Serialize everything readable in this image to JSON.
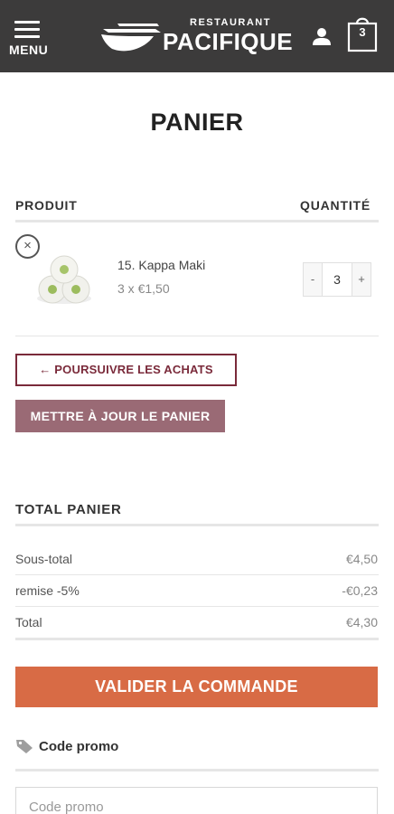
{
  "header": {
    "menu_label": "MENU",
    "logo_small": "RESTAURANT",
    "logo_big": "PACIFIQUE",
    "cart_count": "3",
    "background": "#3c3b3b"
  },
  "page": {
    "title": "PANIER"
  },
  "table": {
    "col_product": "PRODUIT",
    "col_quantity": "QUANTITÉ"
  },
  "item": {
    "remove_glyph": "×",
    "name": "15. Kappa Maki",
    "price": "3 x €1,50",
    "qty_minus": "-",
    "qty_value": "3",
    "qty_plus": "+"
  },
  "actions": {
    "continue_label": "← POURSUIVRE LES ACHATS",
    "update_label": "METTRE À JOUR LE PANIER"
  },
  "totals": {
    "title": "TOTAL PANIER",
    "rows": [
      {
        "label": "Sous-total",
        "value": "€4,50"
      },
      {
        "label": "remise -5%",
        "value": "-€0,23"
      },
      {
        "label": "Total",
        "value": "€4,30"
      }
    ]
  },
  "checkout": {
    "label": "VALIDER LA COMMANDE",
    "color": "#d86b45"
  },
  "promo": {
    "heading": "Code promo",
    "placeholder": "Code promo"
  },
  "icons": {
    "menu": "hamburger-icon",
    "user": "user-icon",
    "cart": "shopping-bag-icon",
    "remove": "close-circle-icon",
    "promo": "tag-icon"
  }
}
